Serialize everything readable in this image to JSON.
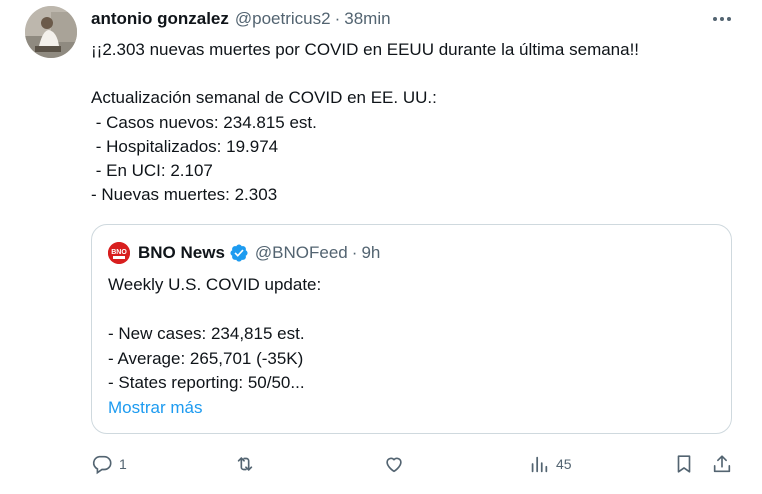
{
  "author": {
    "name": "antonio gonzalez",
    "handle": "@poetricus2",
    "separator": "·",
    "time": "38min"
  },
  "tweet_text": "¡¡2.303 nuevas muertes por COVID en EEUU durante la última semana!!\n\nActualización semanal de COVID en EE. UU.:\n - Casos nuevos: 234.815 est.\n - Hospitalizados: 19.974\n - En UCI: 2.107\n- Nuevas muertes: 2.303",
  "quote": {
    "logo_text": "BNO",
    "name": "BNO News",
    "handle": "@BNOFeed",
    "separator": "·",
    "time": "9h",
    "text": "Weekly U.S. COVID update:\n\n- New cases: 234,815 est.\n- Average: 265,701 (-35K)\n- States reporting: 50/50...",
    "show_more": "Mostrar más"
  },
  "actions": {
    "reply_count": "1",
    "retweet_count": "",
    "like_count": "",
    "views_count": "45"
  },
  "colors": {
    "text": "#0f1419",
    "muted": "#536471",
    "link": "#1d9bf0",
    "verified": "#1d9bf0",
    "border": "#cfd9de",
    "bno_red": "#d81e1e"
  },
  "icons": [
    "more-icon",
    "verified-icon",
    "reply-icon",
    "retweet-icon",
    "like-icon",
    "views-icon",
    "bookmark-icon",
    "share-icon"
  ]
}
